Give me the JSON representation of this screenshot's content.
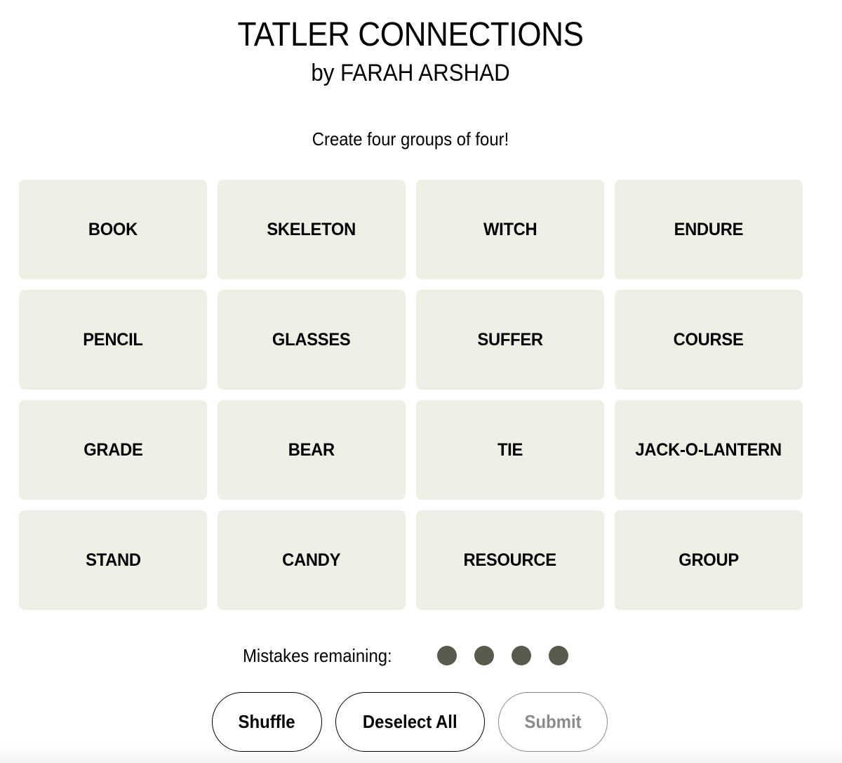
{
  "header": {
    "title": "TATLER CONNECTIONS",
    "byline": "by FARAH ARSHAD",
    "instructions": "Create four groups of four!"
  },
  "tiles": [
    "BOOK",
    "SKELETON",
    "WITCH",
    "ENDURE",
    "PENCIL",
    "GLASSES",
    "SUFFER",
    "COURSE",
    "GRADE",
    "BEAR",
    "TIE",
    "JACK-O-LANTERN",
    "STAND",
    "CANDY",
    "RESOURCE",
    "GROUP"
  ],
  "mistakes": {
    "label": "Mistakes remaining:",
    "remaining": 4,
    "dot_color": "#5a594e"
  },
  "buttons": {
    "shuffle": "Shuffle",
    "deselect_all": "Deselect All",
    "submit": "Submit",
    "submit_enabled": false
  },
  "colors": {
    "tile_bg": "#efefe6",
    "disabled": "#8a8a8a"
  }
}
